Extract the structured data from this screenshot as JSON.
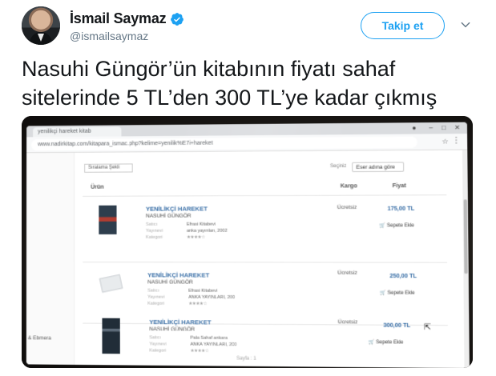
{
  "tweet": {
    "display_name": "İsmail Saymaz",
    "handle": "@ismailsaymaz",
    "follow_label": "Takip et",
    "text": "Nasuhi Güngör’ün kitabının fiyatı  sahaf\nsitelerinde 5 TL’den 300 TL’ye kadar çıkmış"
  },
  "photo": {
    "tab_title": "yenilikçi hareket kitab",
    "url": "www.nadirkitap.com/kitapara_ismac.php?kelime=yenilik%E7i+hareket",
    "side_labels": [
      "",
      "",
      "",
      "",
      "",
      "& Ebmera"
    ],
    "sort_left": "Sıralama Şekli",
    "sort_label": "Seçiniz",
    "sort_value": "Eser adına göre",
    "col_product": "Ürün",
    "col_shipping": "Kargo",
    "col_price": "Fiyat",
    "books": [
      {
        "title": "YENİLİKÇİ HAREKET",
        "author": "NASUHİ GÜNGÖR",
        "meta1": "Satıcı",
        "val1": "Efrasi Kitabevi",
        "meta2": "Yayınevi",
        "val2": "anka yayınları, 2002",
        "meta3": "Kategori",
        "val3": "★★★★☆",
        "shipping": "Ücretsiz",
        "price": "175,00 TL",
        "cart": "Sepete Ekle"
      },
      {
        "title": "YENİLİKÇİ HAREKET",
        "author": "NASUHİ GÜNGÖR",
        "meta1": "Satıcı",
        "val1": "Efrasi Kitabevi",
        "meta2": "Yayınevi",
        "val2": "ANKA YAYINLARI, 200",
        "meta3": "Kategori",
        "val3": "★★★★☆",
        "shipping": "Ücretsiz",
        "price": "250,00 TL",
        "cart": "Sepete Ekle"
      },
      {
        "title": "YENİLİKÇİ HAREKET",
        "author": "NASUHİ GÜNGÖR",
        "meta1": "Satıcı",
        "val1": "Pala Sahaf ankara",
        "meta2": "Yayınevi",
        "val2": "ANKA YAYINLARI, 200",
        "meta3": "Kategori",
        "val3": "★★★★☆",
        "shipping": "Ücretsiz",
        "price": "300,00 TL",
        "cart": "Sepete Ekle"
      }
    ],
    "pagination": "Sayfa : 1"
  }
}
